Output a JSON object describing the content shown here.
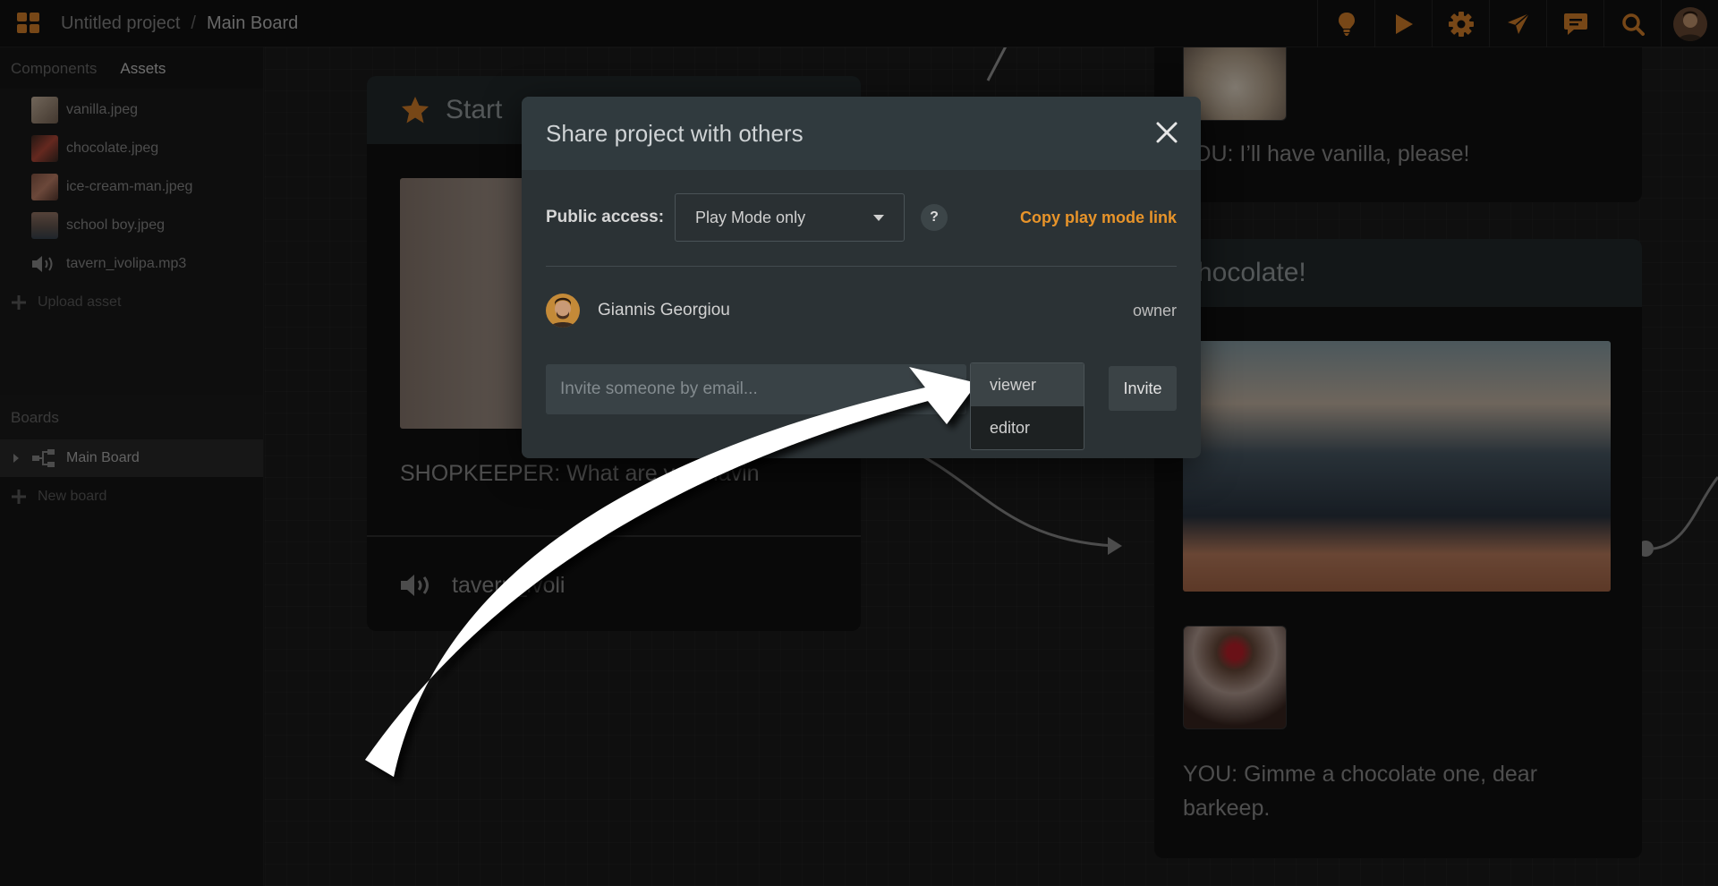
{
  "header": {
    "project": "Untitled project",
    "separator": "/",
    "board": "Main Board",
    "icons": [
      "apps-grid-icon",
      "lightbulb-icon",
      "play-icon",
      "gear-icon",
      "send-icon",
      "chat-icon",
      "search-icon",
      "user-avatar"
    ]
  },
  "sidebar": {
    "tabs": [
      {
        "label": "Components"
      },
      {
        "label": "Assets"
      }
    ],
    "assets": [
      {
        "label": "vanilla.jpeg"
      },
      {
        "label": "chocolate.jpeg"
      },
      {
        "label": "ice-cream-man.jpeg"
      },
      {
        "label": "school boy.jpeg"
      },
      {
        "label": "tavern_ivolipa.mp3"
      }
    ],
    "upload_label": "Upload asset",
    "boards_title": "Boards",
    "boards": [
      {
        "label": "Main Board"
      }
    ],
    "new_board_label": "New board"
  },
  "canvas": {
    "start_node": {
      "title": "Start",
      "text": "SHOPKEEPER: What are you havin",
      "text_tail": "?",
      "audio": "tavern_ivoli"
    },
    "vanilla_node": {
      "text": "OU: I’ll have vanilla, please!"
    },
    "chocolate_node": {
      "title": "hocolate!",
      "text": "YOU: Gimme a chocolate one, dear barkeep."
    }
  },
  "modal": {
    "title": "Share project with others",
    "public_access_label": "Public access:",
    "public_access_value": "Play Mode only",
    "help_label": "?",
    "copy_link_label": "Copy play mode link",
    "members": [
      {
        "name": "Giannis Georgiou",
        "role": "owner"
      }
    ],
    "invite_placeholder": "Invite someone by email...",
    "role_options": [
      {
        "label": "viewer",
        "selected": true
      },
      {
        "label": "editor",
        "selected": false
      }
    ],
    "invite_button": "Invite"
  },
  "colors": {
    "accent_orange": "#d9822b",
    "link_orange": "#e8942a",
    "modal_bg": "#2b3235"
  }
}
